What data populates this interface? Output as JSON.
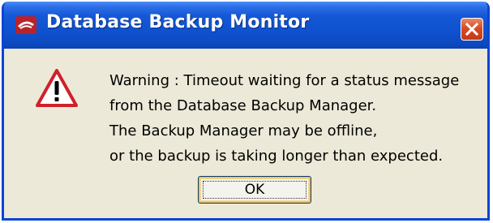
{
  "window": {
    "title": "Database Backup Monitor",
    "title_icon": "app-logo-icon",
    "close_icon": "close-icon"
  },
  "dialog": {
    "icon": "warning-icon",
    "message_lines": [
      "Warning : Timeout waiting for a status message",
      "from the Database Backup Manager.",
      "The Backup Manager may be offline,",
      "or the backup is taking longer than expected."
    ],
    "ok_label": "OK"
  },
  "colors": {
    "titlebar": "#0f52d0",
    "close_button": "#d94b24",
    "dialog_background": "#ece9d8",
    "warning_red": "#d0202a"
  }
}
